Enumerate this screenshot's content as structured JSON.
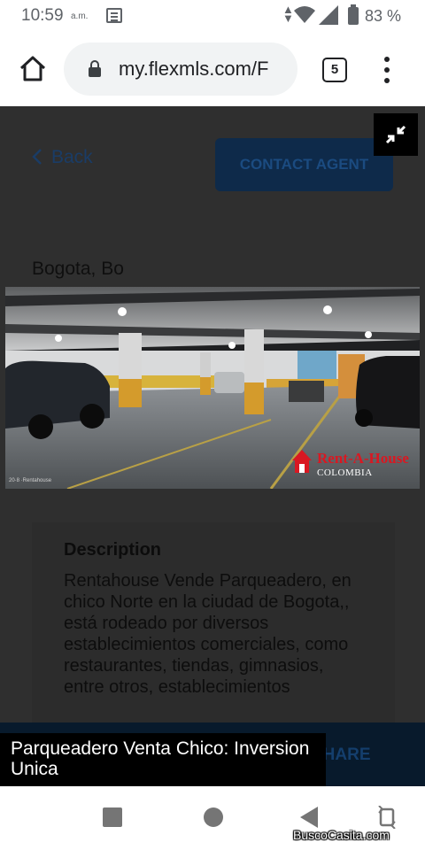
{
  "status_bar": {
    "time": "10:59",
    "ampm": "a.m.",
    "battery": "83 %"
  },
  "browser": {
    "url": "my.flexmls.com/F",
    "tab_count": "5"
  },
  "listing": {
    "back_label": "Back",
    "contact_label": "CONTACT AGENT",
    "location": "Bogota, Bo",
    "photo": {
      "credit": "20·8 ·Rentahouse",
      "brand_name": "Rent-A-House",
      "brand_sub": "COLOMBIA"
    },
    "description_title": "Description",
    "description_text": "Rentahouse Vende Parqueadero, en chico Norte en la ciudad de Bogota,, está rodeado por diversos establecimientos comerciales, como restaurantes, tiendas, gimnasios, entre otros, establecimientos",
    "share_label": "SHARE",
    "caption": "Parqueadero Venta Chico: Inversion Unica"
  },
  "watermark": "BuscoCasita.com",
  "colors": {
    "page_dim": "#2f2f2f",
    "primary_dark": "#0e2a4a",
    "brand_red": "#d91822",
    "nav_gray": "#757575"
  },
  "icons": {
    "home": "home-icon",
    "lock": "lock-icon",
    "menu": "more-vert-icon",
    "expand": "fullscreen-exit-icon"
  }
}
